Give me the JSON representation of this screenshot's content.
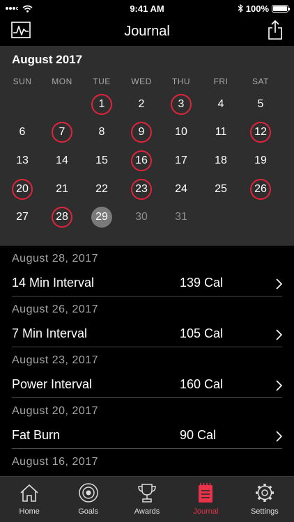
{
  "status_bar": {
    "time": "9:41 AM",
    "battery": "100%"
  },
  "nav": {
    "title": "Journal"
  },
  "calendar": {
    "month": "August 2017",
    "weekdays": [
      "SUN",
      "MON",
      "TUE",
      "WED",
      "THU",
      "FRI",
      "SAT"
    ],
    "weeks": [
      [
        "",
        "",
        "1",
        "2",
        "3",
        "4",
        "5"
      ],
      [
        "6",
        "7",
        "8",
        "9",
        "10",
        "11",
        "12"
      ],
      [
        "13",
        "14",
        "15",
        "16",
        "17",
        "18",
        "19"
      ],
      [
        "20",
        "21",
        "22",
        "23",
        "24",
        "25",
        "26"
      ],
      [
        "27",
        "28",
        "29",
        "30",
        "31",
        "",
        ""
      ]
    ],
    "workout_days": [
      "1",
      "3",
      "7",
      "9",
      "12",
      "16",
      "20",
      "23",
      "26",
      "28"
    ],
    "today": "29",
    "future_days": [
      "30",
      "31"
    ],
    "ring_color": "#e0243c"
  },
  "journal": {
    "entries": [
      {
        "date": "August 28, 2017",
        "name": "14 Min Interval",
        "calories": "139 Cal"
      },
      {
        "date": "August 26, 2017",
        "name": "7 Min Interval",
        "calories": "105 Cal"
      },
      {
        "date": "August 23, 2017",
        "name": "Power Interval",
        "calories": "160 Cal"
      },
      {
        "date": "August 20, 2017",
        "name": "Fat Burn",
        "calories": "90 Cal"
      }
    ],
    "partial_date": "August 16, 2017"
  },
  "tab_bar": {
    "tabs": [
      {
        "label": "Home",
        "icon": "home-icon"
      },
      {
        "label": "Goals",
        "icon": "target-icon"
      },
      {
        "label": "Awards",
        "icon": "trophy-icon"
      },
      {
        "label": "Journal",
        "icon": "journal-icon"
      },
      {
        "label": "Settings",
        "icon": "gear-icon"
      }
    ],
    "active": "Journal",
    "active_color": "#e9334a"
  }
}
